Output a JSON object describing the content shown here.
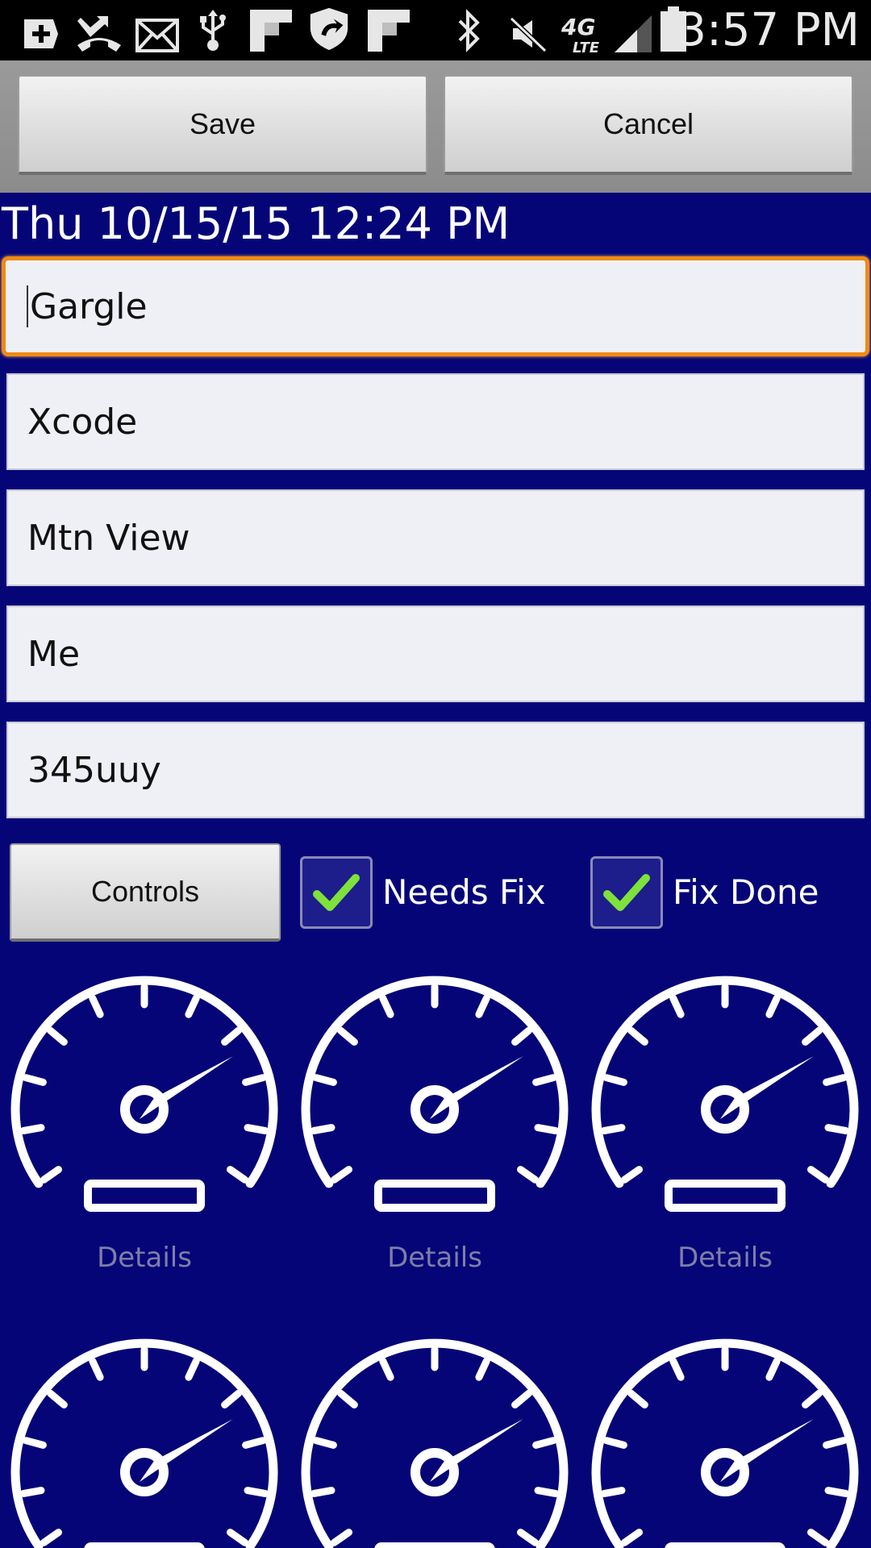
{
  "status_bar": {
    "time": "3:57 PM",
    "icons": [
      "add-icon",
      "missed-call-icon",
      "mail-icon",
      "usb-icon",
      "flipboard-icon",
      "shield-icon",
      "flipboard-icon",
      "bluetooth-icon",
      "mute-icon",
      "4g-lte-icon",
      "signal-icon",
      "battery-icon"
    ]
  },
  "toolbar": {
    "save_label": "Save",
    "cancel_label": "Cancel"
  },
  "date_label": "Thu 10/15/15 12:24 PM",
  "fields": [
    "Gargle",
    "Xcode",
    "Mtn View",
    "Me",
    "345uuy"
  ],
  "controls": {
    "button_label": "Controls",
    "needs_fix_label": "Needs Fix",
    "needs_fix_checked": true,
    "fix_done_label": "Fix Done",
    "fix_done_checked": true
  },
  "gauges": [
    {
      "label": "Details"
    },
    {
      "label": "Details"
    },
    {
      "label": "Details"
    }
  ],
  "colors": {
    "background": "#050578",
    "focus_border": "#f08a14",
    "check_mark": "#7fe23a",
    "details_text": "#7e7ea8"
  }
}
